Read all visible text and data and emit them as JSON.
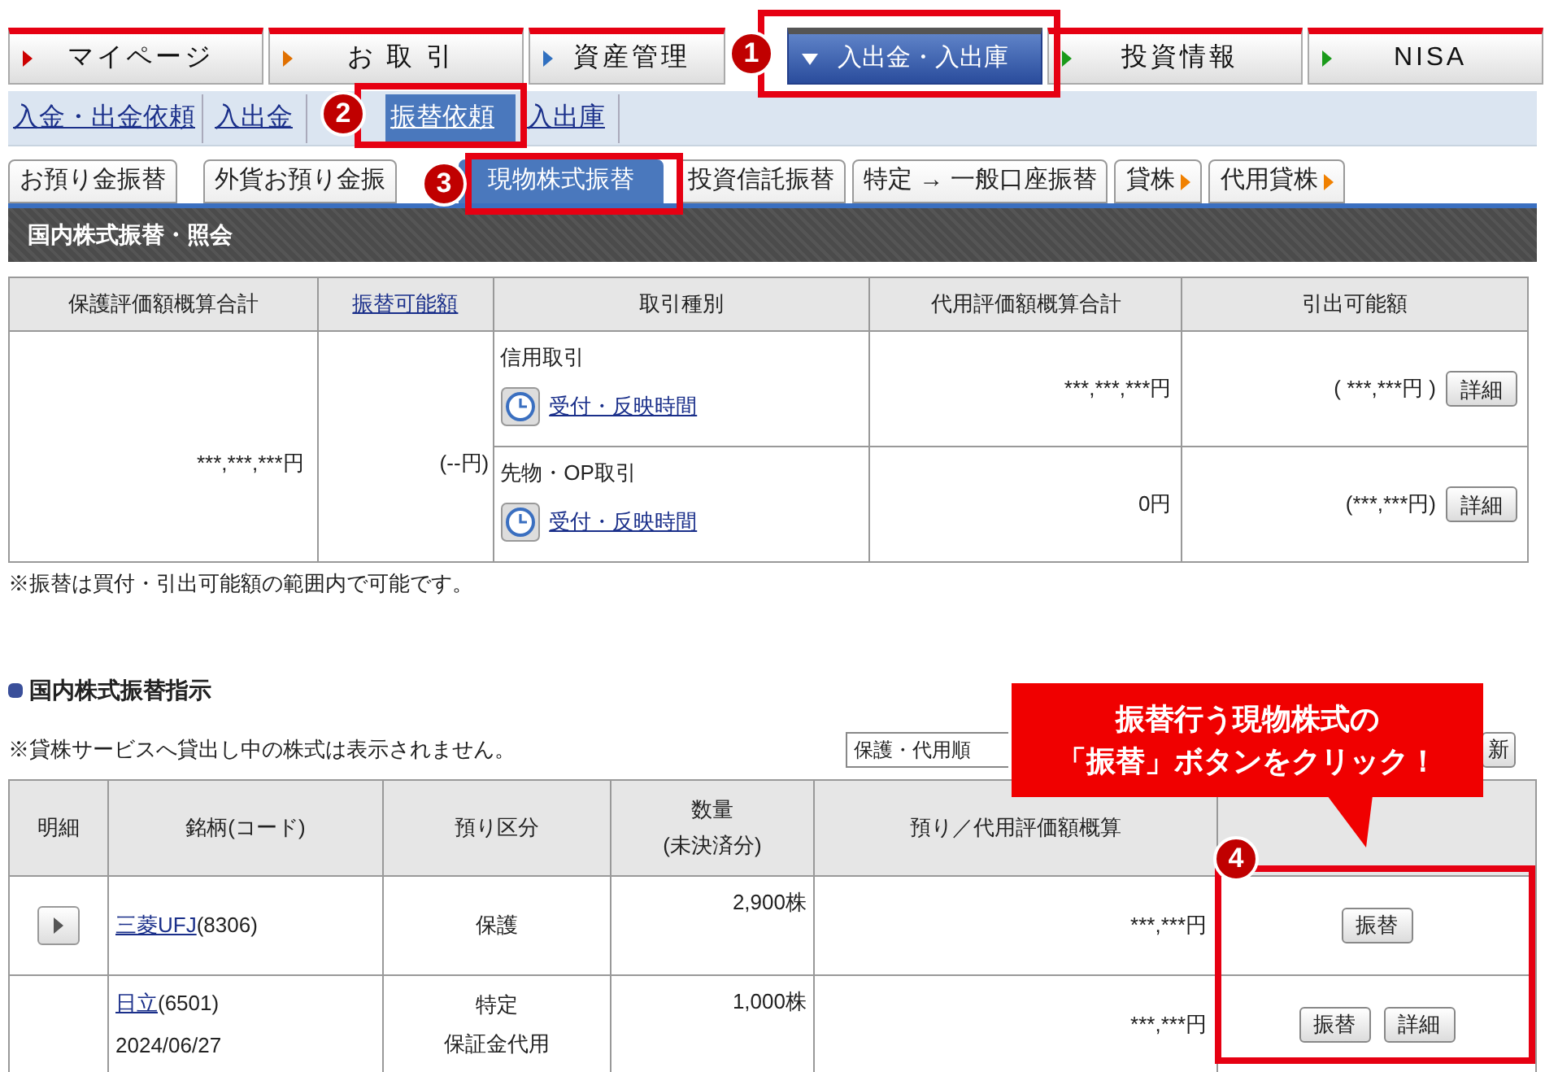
{
  "main_nav": [
    {
      "label": "マイページ",
      "color": "#cc0000",
      "selected": false
    },
    {
      "label": "お 取 引",
      "color": "#e07000",
      "selected": false
    },
    {
      "label": "資産管理",
      "color": "#3070c0",
      "selected": false
    },
    {
      "label": "入出金・入出庫",
      "color": "#ffffff",
      "selected": true
    },
    {
      "label": "投資情報",
      "color": "#1a9a1a",
      "selected": false
    },
    {
      "label": "NISA",
      "color": "#1a9a1a",
      "selected": false
    }
  ],
  "sub_nav": [
    {
      "label": "入金・出金依頼",
      "selected": false
    },
    {
      "label": "入出金",
      "selected": false
    },
    {
      "label": "振替依頼",
      "selected": true
    },
    {
      "label": "入出庫",
      "selected": false
    }
  ],
  "tabs": [
    {
      "label": "お預り金振替",
      "selected": false,
      "arrow": false
    },
    {
      "label": "外貨お預り金振",
      "selected": false,
      "arrow": false
    },
    {
      "label": "現物株式振替",
      "selected": true,
      "arrow": false
    },
    {
      "label": "投資信託振替",
      "selected": false,
      "arrow": false
    },
    {
      "label": "特定 → 一般口座振替",
      "selected": false,
      "arrow": false
    },
    {
      "label": "貸株",
      "selected": false,
      "arrow": true
    },
    {
      "label": "代用貸株",
      "selected": false,
      "arrow": true
    }
  ],
  "panel_title": "国内株式振替・照会",
  "summary_table": {
    "columns": [
      {
        "label": "保護評価額概算合計",
        "link": false
      },
      {
        "label": "振替可能額",
        "link": true
      },
      {
        "label": "取引種別",
        "link": false
      },
      {
        "label": "代用評価額概算合計",
        "link": false
      },
      {
        "label": "引出可能額",
        "link": false
      }
    ],
    "protected_total": "***,***,***円",
    "transferable": "(--円)",
    "rows": [
      {
        "type": "信用取引",
        "link": "受付・反映時間",
        "substitute_total": "***,***,***円",
        "withdrawable": "( ***,***円 )",
        "button": "詳細"
      },
      {
        "type": "先物・OP取引",
        "link": "受付・反映時間",
        "substitute_total": "0円",
        "withdrawable": "(***,***円)",
        "button": "詳細"
      }
    ]
  },
  "summary_note": "※振替は買付・引出可能額の範囲内で可能です。",
  "section_title": "国内株式振替指示",
  "section_note": "※貸株サービスへ貸出し中の株式は表示されません。",
  "sort_select": {
    "value": "保護・代用順"
  },
  "refresh_button": "新",
  "holdings_table": {
    "columns": [
      {
        "lines": [
          "明細"
        ]
      },
      {
        "lines": [
          "銘柄(コード)"
        ]
      },
      {
        "lines": [
          "預り区分"
        ]
      },
      {
        "lines": [
          "数量",
          "(未決済分)"
        ]
      },
      {
        "lines": [
          "預り／代用評価額概算"
        ]
      }
    ],
    "rows": [
      {
        "expandable": true,
        "name": "三菱UFJ",
        "code": "(8306)",
        "date": null,
        "category": [
          "保護"
        ],
        "quantity": "2,900株",
        "value": "***,***円",
        "buttons": [
          "振替"
        ]
      },
      {
        "expandable": false,
        "name": "日立",
        "code": "(6501)",
        "date": "2024/06/27",
        "category": [
          "特定",
          "保証金代用"
        ],
        "quantity": "1,000株",
        "value": "***,***円",
        "buttons": [
          "振替",
          "詳細"
        ]
      }
    ]
  },
  "callout": {
    "lines": [
      "振替行う現物株式の",
      "「振替」ボタンをクリック！"
    ]
  },
  "markers": [
    "1",
    "2",
    "3",
    "4"
  ]
}
